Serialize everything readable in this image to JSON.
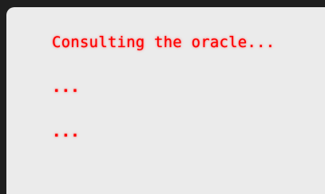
{
  "output": {
    "lines": [
      "Consulting the oracle...",
      "...",
      "..."
    ]
  },
  "colors": {
    "background": "#1f1f1f",
    "panel": "#ebebeb",
    "text": "#ff0000"
  }
}
